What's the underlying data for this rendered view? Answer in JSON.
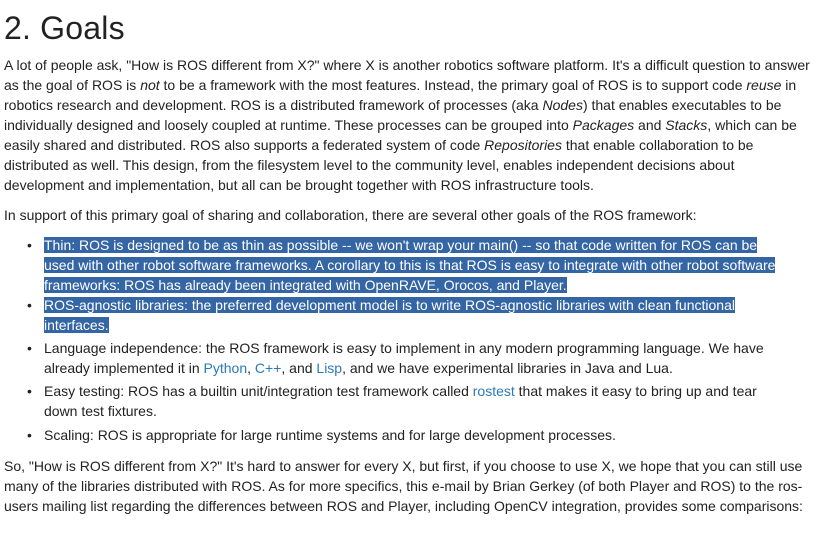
{
  "heading": "2. Goals",
  "intro": {
    "t1": "A lot of people ask, \"How is ROS different from X?\" where X is another robotics software platform. It's a difficult question to answer as the goal of ROS is ",
    "not": "not",
    "t2": " to be a framework with the most features. Instead, the primary goal of ROS is to support code ",
    "reuse": "reuse",
    "t3": " in robotics research and development. ROS is a distributed framework of processes (aka ",
    "nodes": "Nodes",
    "t4": ") that enables executables to be individually designed and loosely coupled at runtime. These processes can be grouped into ",
    "packages": "Packages",
    "t5": " and ",
    "stacks": "Stacks",
    "t6": ", which can be easily shared and distributed. ROS also supports a federated system of code ",
    "repositories": "Repositories",
    "t7": " that enable collaboration to be distributed as well. This design, from the filesystem level to the community level, enables independent decisions about development and implementation, but all can be brought together with ROS infrastructure tools."
  },
  "support_text": "In support of this primary goal of sharing and collaboration, there are several other goals of the ROS framework:",
  "goals": {
    "thin": "Thin: ROS is designed to be as thin as possible -- we won't wrap your main() -- so that code written for ROS can be used with other robot software frameworks. A corollary to this is that ROS is easy to integrate with other robot software frameworks: ROS has already been integrated with OpenRAVE, Orocos, and Player.",
    "agnostic": "ROS-agnostic libraries: the preferred development model is to write ROS-agnostic libraries with clean functional interfaces.",
    "lang_t1": "Language independence: the ROS framework is easy to implement in any modern programming language. We have already implemented it in ",
    "lang_python": "Python",
    "lang_t2": ", ",
    "lang_cpp": "C++",
    "lang_t3": ", and ",
    "lang_lisp": "Lisp",
    "lang_t4": ", and we have experimental libraries in Java and Lua.",
    "test_t1": "Easy testing: ROS has a builtin unit/integration test framework called ",
    "test_link": "rostest",
    "test_t2": " that makes it easy to bring up and tear down test fixtures.",
    "scaling": "Scaling: ROS is appropriate for large runtime systems and for large development processes."
  },
  "closing": "So, \"How is ROS different from X?\" It's hard to answer for every X, but first, if you choose to use X, we hope that you can still use many of the libraries distributed with ROS. As for more specifics, this e-mail by Brian Gerkey (of both Player and ROS) to the ros-users mailing list regarding the differences between ROS and Player, including OpenCV integration, provides some comparisons:",
  "colors": {
    "text": "#222222",
    "link": "#2a7ab9",
    "selection_bg": "#3465a4",
    "selection_text": "#ffffff"
  }
}
